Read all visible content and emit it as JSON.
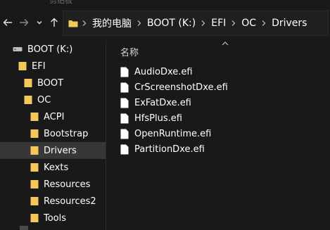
{
  "window": {
    "top_ghost_text": "剪贴板"
  },
  "nav": {
    "back_icon": "arrow-left-icon",
    "forward_icon": "arrow-right-icon",
    "recent_icon": "chevron-down-icon",
    "up_icon": "arrow-up-icon"
  },
  "breadcrumb": {
    "items": [
      "我的电脑",
      "BOOT (K:)",
      "EFI",
      "OC",
      "Drivers"
    ]
  },
  "sidebar": {
    "items": [
      {
        "label": "BOOT (K:)",
        "icon": "drive-icon",
        "selected": false
      },
      {
        "label": "EFI",
        "icon": "folder-icon",
        "selected": false
      },
      {
        "label": "BOOT",
        "icon": "folder-icon",
        "selected": false
      },
      {
        "label": "OC",
        "icon": "folder-icon",
        "selected": false
      },
      {
        "label": "ACPI",
        "icon": "folder-icon",
        "selected": false
      },
      {
        "label": "Bootstrap",
        "icon": "folder-icon",
        "selected": false
      },
      {
        "label": "Drivers",
        "icon": "folder-icon",
        "selected": true
      },
      {
        "label": "Kexts",
        "icon": "folder-icon",
        "selected": false
      },
      {
        "label": "Resources",
        "icon": "folder-icon",
        "selected": false
      },
      {
        "label": "Resources2",
        "icon": "folder-icon",
        "selected": false
      },
      {
        "label": "Tools",
        "icon": "folder-icon",
        "selected": false
      }
    ]
  },
  "content": {
    "column_header": "名称",
    "files": [
      {
        "name": "AudioDxe.efi",
        "icon": "file-icon"
      },
      {
        "name": "CrScreenshotDxe.efi",
        "icon": "file-icon"
      },
      {
        "name": "ExFatDxe.efi",
        "icon": "file-icon"
      },
      {
        "name": "HfsPlus.efi",
        "icon": "file-icon"
      },
      {
        "name": "OpenRuntime.efi",
        "icon": "file-icon"
      },
      {
        "name": "PartitionDxe.efi",
        "icon": "file-icon"
      }
    ]
  },
  "colors": {
    "background": "#191919",
    "selected_row": "#373737",
    "folder": "#f2c85b",
    "text": "#ffffff"
  }
}
